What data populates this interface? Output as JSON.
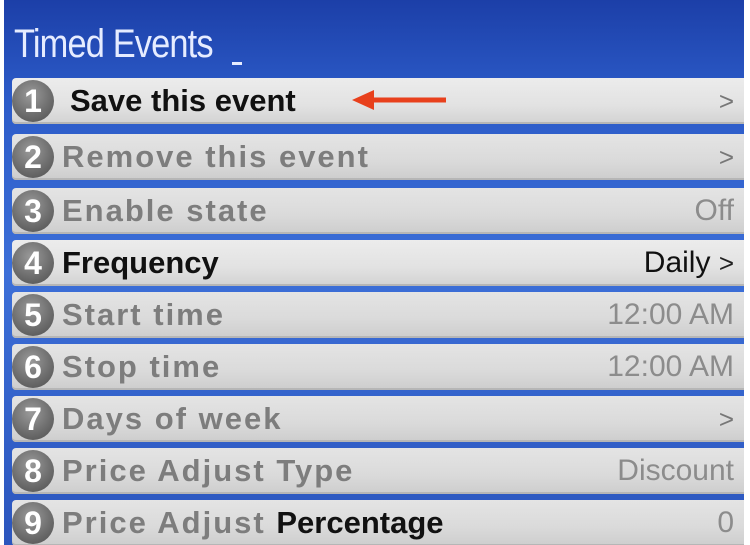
{
  "header": {
    "title": "Timed Events"
  },
  "menu": {
    "items": [
      {
        "number": "1",
        "label": "Save this event",
        "value": "",
        "chevron": ">"
      },
      {
        "number": "2",
        "label": "Remove this event",
        "value": "",
        "chevron": ">"
      },
      {
        "number": "3",
        "label": "Enable state",
        "value": "Off",
        "chevron": ""
      },
      {
        "number": "4",
        "label": "Frequency",
        "value": "Daily",
        "chevron": ">"
      },
      {
        "number": "5",
        "label": "Start time",
        "value": "12:00 AM",
        "chevron": ""
      },
      {
        "number": "6",
        "label": "Stop time",
        "value": "12:00 AM",
        "chevron": ""
      },
      {
        "number": "7",
        "label": "Days of week",
        "value": "",
        "chevron": ">"
      },
      {
        "number": "8",
        "label": "Price Adjust Type",
        "value": "Discount",
        "chevron": ""
      },
      {
        "number": "9",
        "label_part1": "Price Adjust",
        "label_part2": "Percentage",
        "value": "0",
        "chevron": ""
      }
    ]
  },
  "annotation": {
    "arrow_color": "#e8401c"
  }
}
